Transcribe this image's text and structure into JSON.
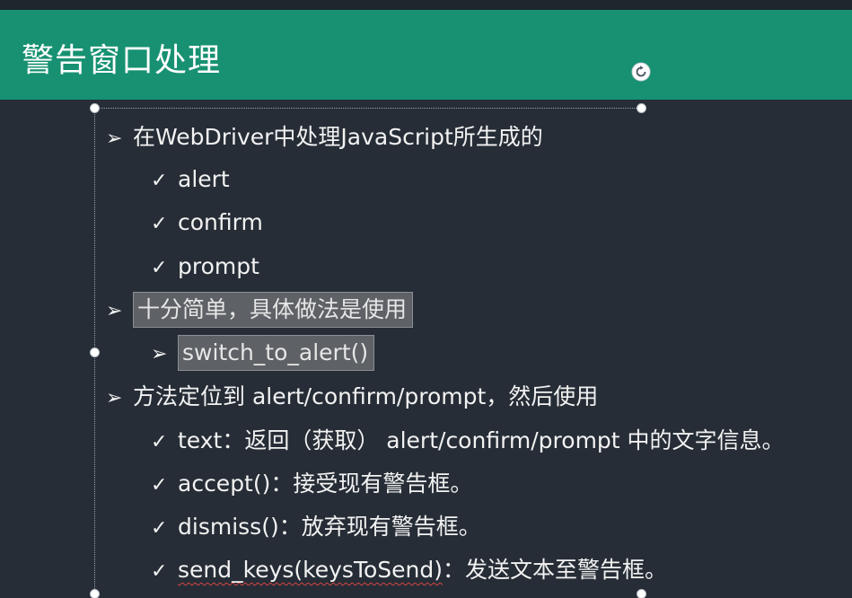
{
  "slide": {
    "title": "警告窗口处理",
    "icons": {
      "rotate": "rotate-icon",
      "arrow_bullet": "arrow-bullet-icon",
      "check_bullet": "check-bullet-icon"
    },
    "colors": {
      "title_bar": "#179172",
      "background": "#262d36",
      "text": "#f2f2f2",
      "highlight": "#5e6166",
      "spell_underline": "#d94343"
    },
    "markers": {
      "arrow": "➢",
      "check": "✓"
    },
    "bullets": [
      {
        "text": "在WebDriver中处理JavaScript所生成的",
        "subitems": [
          "alert",
          "confirm",
          "prompt"
        ]
      },
      {
        "text": "十分简单，具体做法是使用",
        "subitems": [
          "switch_to_alert()"
        ]
      },
      {
        "text": "方法定位到 alert/confirm/prompt，然后使用",
        "subitems": [
          "text：返回（获取） alert/confirm/prompt 中的文字信息。",
          "accept()：接受现有警告框。",
          "dismiss()：放弃现有警告框。"
        ],
        "last_item": {
          "code": "send_keys(keysToSend)",
          "desc": "：发送文本至警告框。"
        }
      }
    ]
  }
}
